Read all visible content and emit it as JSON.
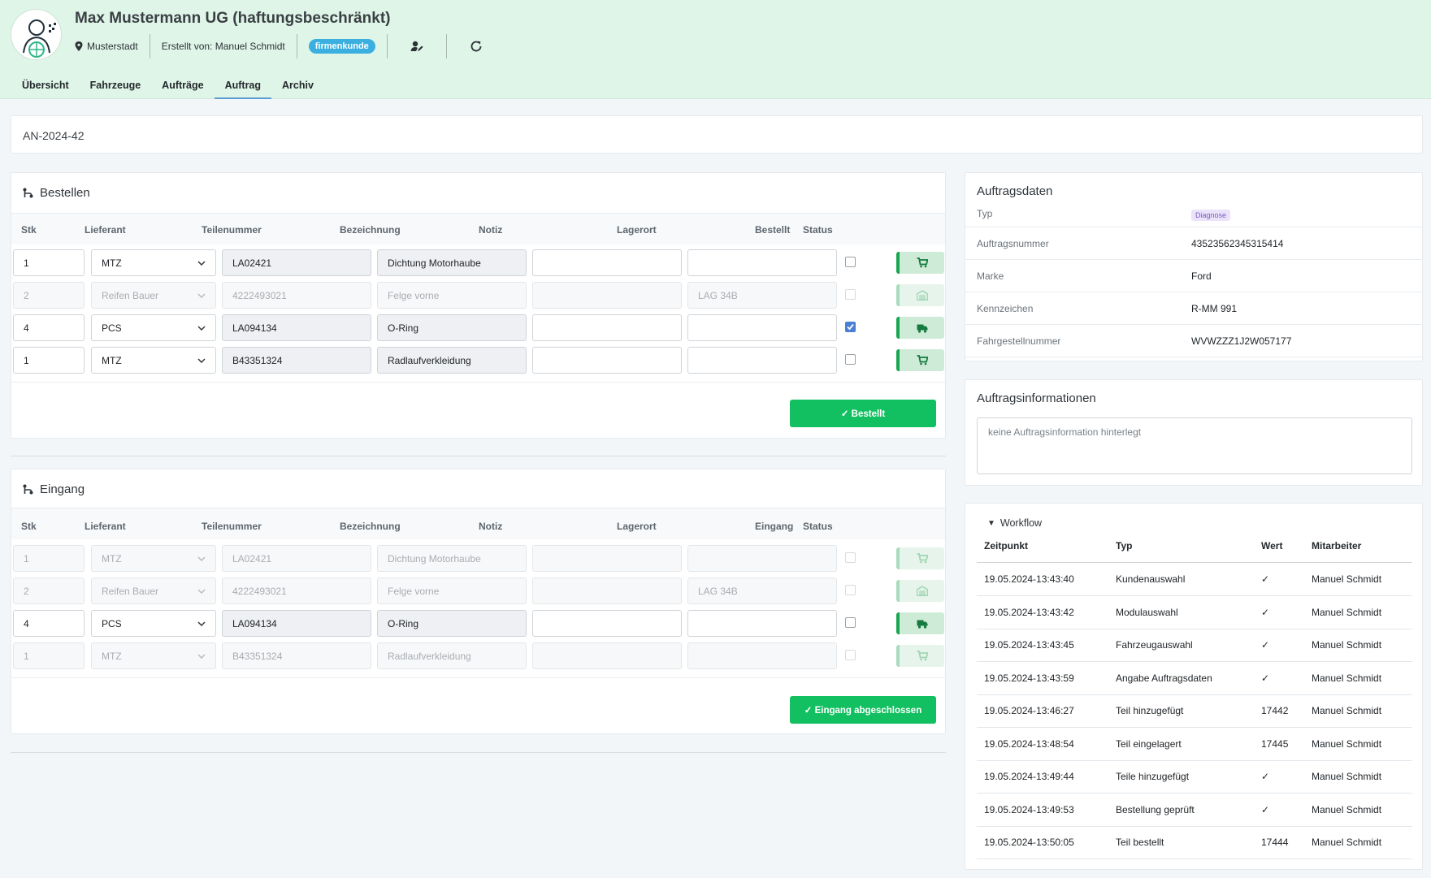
{
  "header": {
    "company": "Max Mustermann UG (haftungsbeschränkt)",
    "location": "Musterstadt",
    "created_by": "Erstellt von: Manuel Schmidt",
    "customer_badge": "firmenkunde",
    "tabs": [
      "Übersicht",
      "Fahrzeuge",
      "Aufträge",
      "Auftrag",
      "Archiv"
    ],
    "active_tab": "Auftrag"
  },
  "order": {
    "number": "AN-2024-42"
  },
  "bestellen": {
    "title": "Bestellen",
    "columns": [
      "Stk",
      "Lieferant",
      "Teilenummer",
      "Bezeichnung",
      "Notiz",
      "Lagerort",
      "Bestellt",
      "Status"
    ],
    "rows": [
      {
        "qty": "1",
        "supplier": "MTZ",
        "part": "LA02421",
        "desc": "Dichtung Motorhaube",
        "note": "",
        "location": "",
        "checked": false,
        "disabled": false,
        "status_icon": "cart-icon"
      },
      {
        "qty": "2",
        "supplier": "Reifen Bauer",
        "part": "4222493021",
        "desc": "Felge vorne",
        "note": "",
        "location": "LAG 34B",
        "checked": false,
        "disabled": true,
        "status_icon": "warehouse-icon"
      },
      {
        "qty": "4",
        "supplier": "PCS",
        "part": "LA094134",
        "desc": "O-Ring",
        "note": "",
        "location": "",
        "checked": true,
        "disabled": false,
        "status_icon": "truck-icon"
      },
      {
        "qty": "1",
        "supplier": "MTZ",
        "part": "B43351324",
        "desc": "Radlaufverkleidung",
        "note": "",
        "location": "",
        "checked": false,
        "disabled": false,
        "status_icon": "cart-icon"
      }
    ],
    "button": "✓ Bestellt"
  },
  "eingang": {
    "title": "Eingang",
    "columns": [
      "Stk",
      "Lieferant",
      "Teilenummer",
      "Bezeichnung",
      "Notiz",
      "Lagerort",
      "Eingang",
      "Status"
    ],
    "rows": [
      {
        "qty": "1",
        "supplier": "MTZ",
        "part": "LA02421",
        "desc": "Dichtung Motorhaube",
        "note": "",
        "location": "",
        "checked": false,
        "disabled": true,
        "status_icon": "cart-icon"
      },
      {
        "qty": "2",
        "supplier": "Reifen Bauer",
        "part": "4222493021",
        "desc": "Felge vorne",
        "note": "",
        "location": "LAG 34B",
        "checked": false,
        "disabled": true,
        "status_icon": "warehouse-icon"
      },
      {
        "qty": "4",
        "supplier": "PCS",
        "part": "LA094134",
        "desc": "O-Ring",
        "note": "",
        "location": "",
        "checked": false,
        "disabled": false,
        "status_icon": "truck-icon"
      },
      {
        "qty": "1",
        "supplier": "MTZ",
        "part": "B43351324",
        "desc": "Radlaufverkleidung",
        "note": "",
        "location": "",
        "checked": false,
        "disabled": true,
        "status_icon": "cart-icon"
      }
    ],
    "button": "✓ Eingang abgeschlossen"
  },
  "auftragsdaten": {
    "title": "Auftragsdaten",
    "type_label": "Typ",
    "type_badge": "Diagnose",
    "rows": [
      {
        "label": "Auftragsnummer",
        "value": "43523562345315414"
      },
      {
        "label": "Marke",
        "value": "Ford"
      },
      {
        "label": "Kennzeichen",
        "value": "R-MM 991"
      },
      {
        "label": "Fahrgestellnummer",
        "value": "WVWZZZ1J2W057177"
      }
    ]
  },
  "auftragsinfo": {
    "title": "Auftragsinformationen",
    "placeholder": "keine Auftragsinformation hinterlegt"
  },
  "workflow": {
    "summary": "Workflow",
    "columns": [
      "Zeitpunkt",
      "Typ",
      "Wert",
      "Mitarbeiter"
    ],
    "rows": [
      {
        "time": "19.05.2024-13:43:40",
        "type": "Kundenauswahl",
        "value": "✓",
        "user": "Manuel Schmidt"
      },
      {
        "time": "19.05.2024-13:43:42",
        "type": "Modulauswahl",
        "value": "✓",
        "user": "Manuel Schmidt"
      },
      {
        "time": "19.05.2024-13:43:45",
        "type": "Fahrzeugauswahl",
        "value": "✓",
        "user": "Manuel Schmidt"
      },
      {
        "time": "19.05.2024-13:43:59",
        "type": "Angabe Auftragsdaten",
        "value": "✓",
        "user": "Manuel Schmidt"
      },
      {
        "time": "19.05.2024-13:46:27",
        "type": "Teil hinzugefügt",
        "value": "17442",
        "user": "Manuel Schmidt"
      },
      {
        "time": "19.05.2024-13:48:54",
        "type": "Teil eingelagert",
        "value": "17445",
        "user": "Manuel Schmidt"
      },
      {
        "time": "19.05.2024-13:49:44",
        "type": "Teile hinzugefügt",
        "value": "✓",
        "user": "Manuel Schmidt"
      },
      {
        "time": "19.05.2024-13:49:53",
        "type": "Bestellung geprüft",
        "value": "✓",
        "user": "Manuel Schmidt"
      },
      {
        "time": "19.05.2024-13:50:05",
        "type": "Teil bestellt",
        "value": "17444",
        "user": "Manuel Schmidt"
      }
    ]
  },
  "colors": {
    "header_bg": "#dff5e8",
    "primary_green": "#13c061",
    "status_green": "#19a651",
    "badge_blue": "#3bb0e0"
  }
}
